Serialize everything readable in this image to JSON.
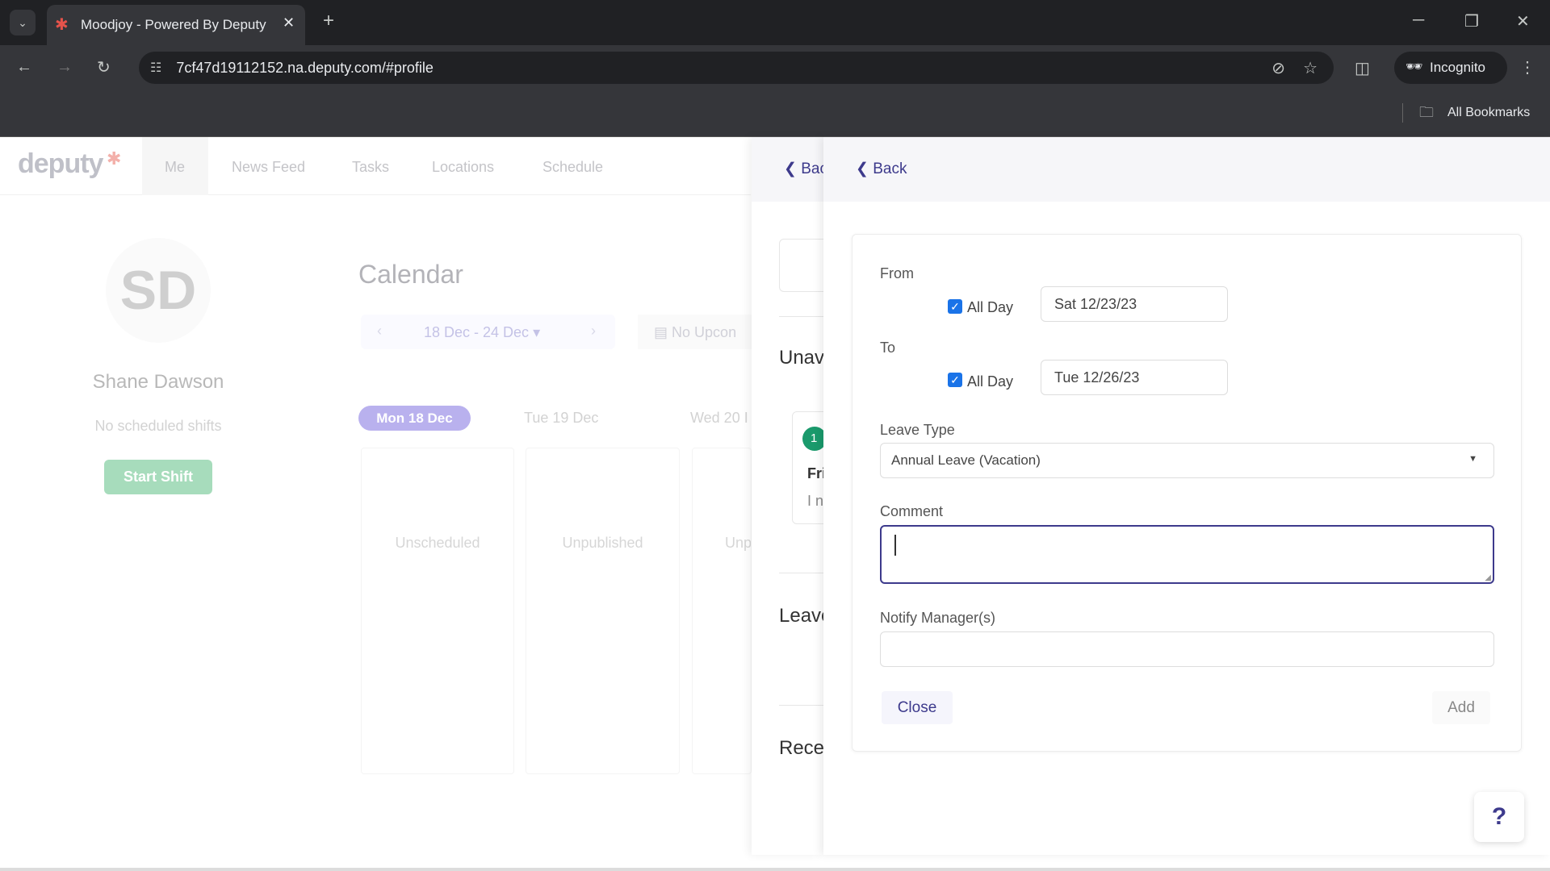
{
  "browser": {
    "tab_title": "Moodjoy - Powered By Deputy",
    "url": "7cf47d19112152.na.deputy.com/#profile",
    "incognito_label": "Incognito",
    "bookmarks_label": "All Bookmarks"
  },
  "nav": {
    "logo": "deputy",
    "items": [
      "Me",
      "News Feed",
      "Tasks",
      "Locations",
      "Schedule"
    ],
    "active": "Me"
  },
  "profile": {
    "initials": "SD",
    "name": "Shane Dawson",
    "status": "No scheduled shifts",
    "start_shift_label": "Start Shift"
  },
  "calendar": {
    "title": "Calendar",
    "range": "18 Dec - 24 Dec",
    "upcoming": "No Upcon",
    "days": [
      "Mon 18 Dec",
      "Tue 19 Dec",
      "Wed 20 I"
    ],
    "columns": [
      "Unscheduled",
      "Unpublished",
      "Unp"
    ]
  },
  "middle_panel": {
    "back_label": "Bac",
    "sections": [
      "Unav",
      "Leave",
      "Rece"
    ],
    "badge": "1",
    "card_title": "Fri",
    "card_text": "I n"
  },
  "leave_form": {
    "back_label": "Back",
    "from_label": "From",
    "to_label": "To",
    "all_day_label": "All Day",
    "from_all_day": true,
    "to_all_day": true,
    "from_date": "Sat 12/23/23",
    "to_date": "Tue 12/26/23",
    "leave_type_label": "Leave Type",
    "leave_type_value": "Annual Leave (Vacation)",
    "comment_label": "Comment",
    "comment_value": "",
    "notify_label": "Notify Manager(s)",
    "notify_value": "",
    "close_label": "Close",
    "add_label": "Add"
  },
  "help_label": "?",
  "colors": {
    "accent": "#3d3a8c",
    "checkbox": "#1a73e8",
    "start_shift": "#9fd8b4",
    "day_pill": "#b5acec",
    "badge": "#1a9a6c"
  }
}
